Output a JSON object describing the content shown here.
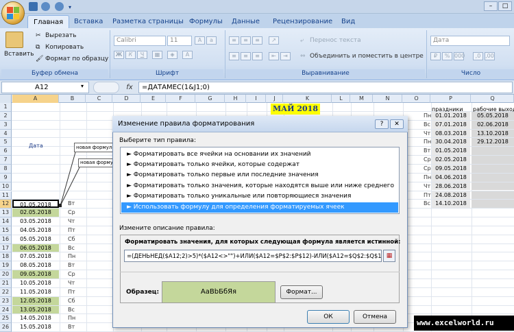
{
  "tabs": [
    "Главная",
    "Вставка",
    "Разметка страницы",
    "Формулы",
    "Данные",
    "Рецензирование",
    "Вид"
  ],
  "ribbon": {
    "paste": "Вставить",
    "cut": "Вырезать",
    "copy": "Копировать",
    "format_painter": "Формат по образцу",
    "clipboard": "Буфер обмена",
    "font_name": "Calibri",
    "font_size": "11",
    "font_group": "Шрифт",
    "wrap_text": "Перенос текста",
    "merge_center": "Объединить и поместить в центре",
    "alignment_group": "Выравнивание",
    "number_format": "Дата",
    "number_group": "Число"
  },
  "formula_bar": {
    "name_box": "A12",
    "fx": "fx",
    "formula": "=ДАТАМЕС(1&J1;0)"
  },
  "columns": [
    "A",
    "B",
    "C",
    "D",
    "E",
    "F",
    "G",
    "H",
    "I",
    "J",
    "K",
    "L",
    "M",
    "N",
    "O",
    "P",
    "Q"
  ],
  "rows": [
    "1",
    "2",
    "3",
    "4",
    "5",
    "6",
    "7",
    "8",
    "9",
    "10",
    "11",
    "12",
    "13",
    "14",
    "15",
    "16",
    "17",
    "18",
    "19",
    "20",
    "21",
    "22",
    "23",
    "24",
    "25",
    "26"
  ],
  "sheet": {
    "title": "МАЙ 2018",
    "date_header": "Дата",
    "note1": "новая формула",
    "note2": "новая формула",
    "holidays_header": "праздники",
    "workdays_header": "рабочие выходные",
    "dates": [
      "01.05.2018",
      "02.05.2018",
      "03.05.2018",
      "04.05.2018",
      "05.05.2018",
      "06.05.2018",
      "07.05.2018",
      "08.05.2018",
      "09.05.2018",
      "10.05.2018",
      "11.05.2018",
      "12.05.2018",
      "13.05.2018",
      "14.05.2018",
      "15.05.2018"
    ],
    "weekdays": [
      "Вт",
      "Ср",
      "Чт",
      "Пт",
      "Сб",
      "Вс",
      "Пн",
      "Вт",
      "Ср",
      "Чт",
      "Пт",
      "Сб",
      "Вс",
      "Пн",
      "Вт"
    ],
    "holiday_days": [
      "Пн",
      "Вс",
      "Чт",
      "Пн",
      "Вт",
      "Ср",
      "Ср",
      "Пн",
      "Чт",
      "Пт",
      "Вс"
    ],
    "holidays": [
      "01.01.2018",
      "07.01.2018",
      "08.03.2018",
      "30.04.2018",
      "01.05.2018",
      "02.05.2018",
      "09.05.2018",
      "04.06.2018",
      "28.06.2018",
      "24.08.2018",
      "14.10.2018"
    ],
    "workdays": [
      "05.05.2018",
      "02.06.2018",
      "13.10.2018",
      "29.12.2018"
    ]
  },
  "dialog": {
    "title": "Изменение правила форматирования",
    "help": "?",
    "close": "✕",
    "choose_type": "Выберите тип правила:",
    "rule_types": [
      "► Форматировать все ячейки на основании их значений",
      "► Форматировать только ячейки, которые содержат",
      "► Форматировать только первые или последние значения",
      "► Форматировать только значения, которые находятся выше или ниже среднего",
      "► Форматировать только уникальные или повторяющиеся значения",
      "► Использовать формулу для определения форматируемых ячеек"
    ],
    "edit_desc": "Измените описание правила:",
    "formula_label": "Форматировать значения, для которых следующая формула является истинной:",
    "formula": "=(ДЕНЬНЕД($A12;2)>5)*($A12<>\"\")+ИЛИ($A12=$P$2:$P$12)-ИЛИ($A12=$Q$2:$Q$12)",
    "sample_label": "Образец:",
    "sample_text": "АаВbБбЯя",
    "format_button": "Формат...",
    "ok": "ОК",
    "cancel": "Отмена"
  },
  "watermark": "www.excelworld.ru"
}
